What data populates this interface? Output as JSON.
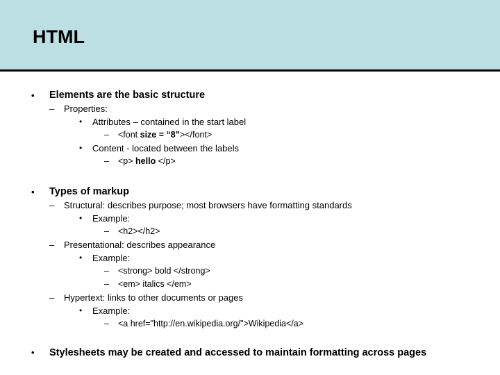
{
  "slide": {
    "title": "HTML",
    "title_bg": "#bcdfe4",
    "title_border": "#000000",
    "background": "#ffffff",
    "text_color": "#000000",
    "bullet_marker_l1": "•",
    "bullet_marker_l2": "–",
    "bullet_marker_l3": "•",
    "bullet_marker_l4": "–"
  },
  "content": {
    "groups": [
      {
        "id": "group-elements",
        "heading": "Elements are the basic structure",
        "lines": [
          {
            "level": 2,
            "text": "Properties:"
          },
          {
            "level": 3,
            "text": "Attributes – contained in the start label"
          },
          {
            "level": 4,
            "pre": "<font ",
            "bold": "size = “8”",
            "post": "></font>"
          },
          {
            "level": 3,
            "text": "Content - located between the labels"
          },
          {
            "level": 4,
            "pre": "<p> ",
            "bold": "hello",
            "post": " </p>"
          }
        ]
      },
      {
        "id": "group-markup",
        "heading": "Types of markup",
        "lines": [
          {
            "level": 2,
            "text": "Structural: describes purpose; most browsers have formatting standards"
          },
          {
            "level": 3,
            "text": "Example:"
          },
          {
            "level": 4,
            "text": "<h2></h2>"
          },
          {
            "level": 2,
            "text": "Presentational: describes appearance"
          },
          {
            "level": 3,
            "text": "Example:"
          },
          {
            "level": 4,
            "text": "<strong> bold </strong>"
          },
          {
            "level": 4,
            "text": "<em> italics </em>"
          },
          {
            "level": 2,
            "text": "Hypertext: links to other documents or pages"
          },
          {
            "level": 3,
            "text": "Example:"
          },
          {
            "level": 4,
            "text": "<a href=\"http://en.wikipedia.org/\">Wikipedia</a>"
          }
        ]
      },
      {
        "id": "group-stylesheets",
        "heading": "Stylesheets may be created and accessed to maintain formatting across pages",
        "lines": []
      }
    ]
  }
}
